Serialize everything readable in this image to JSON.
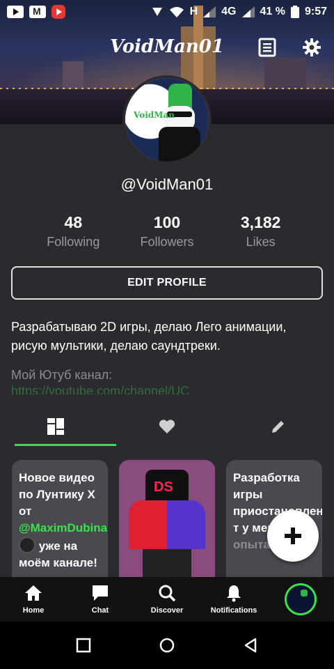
{
  "status_bar": {
    "network": "H",
    "network2": "4G",
    "battery": "41 %",
    "time": "9:57"
  },
  "header": {
    "title": "VoidMan01"
  },
  "profile": {
    "avatar_label": "VoidMan",
    "handle": "@VoidMan01",
    "stats": [
      {
        "value": "48",
        "label": "Following"
      },
      {
        "value": "100",
        "label": "Followers"
      },
      {
        "value": "3,182",
        "label": "Likes"
      }
    ],
    "edit_button": "EDIT PROFILE",
    "bio_line": "Разрабатываю 2D игры, делаю Лего анимации, рисую мультики, делаю саундтреки.",
    "bio_channel_label": "Мой Ютуб канал:",
    "bio_link": "https://youtube.com/channel/UC"
  },
  "tabs": [
    "posts-grid",
    "likes",
    "drafts"
  ],
  "cards": {
    "c1": {
      "part1": "Новое видео по Лунтику Х от",
      "mention": "@MaximDubina",
      "part2": "уже на моём канале!"
    },
    "c2": {
      "figure_label": "DS"
    },
    "c3": {
      "text": "Разработка игры приостановлена, т",
      "text2": "у меня",
      "text3": "опыта в"
    }
  },
  "bottom_nav": {
    "home": "Home",
    "chat": "Chat",
    "discover": "Discover",
    "notifications": "Notifications"
  },
  "colors": {
    "accent": "#39e14a",
    "background": "#2b2a2e",
    "nav_bg": "#121212"
  }
}
